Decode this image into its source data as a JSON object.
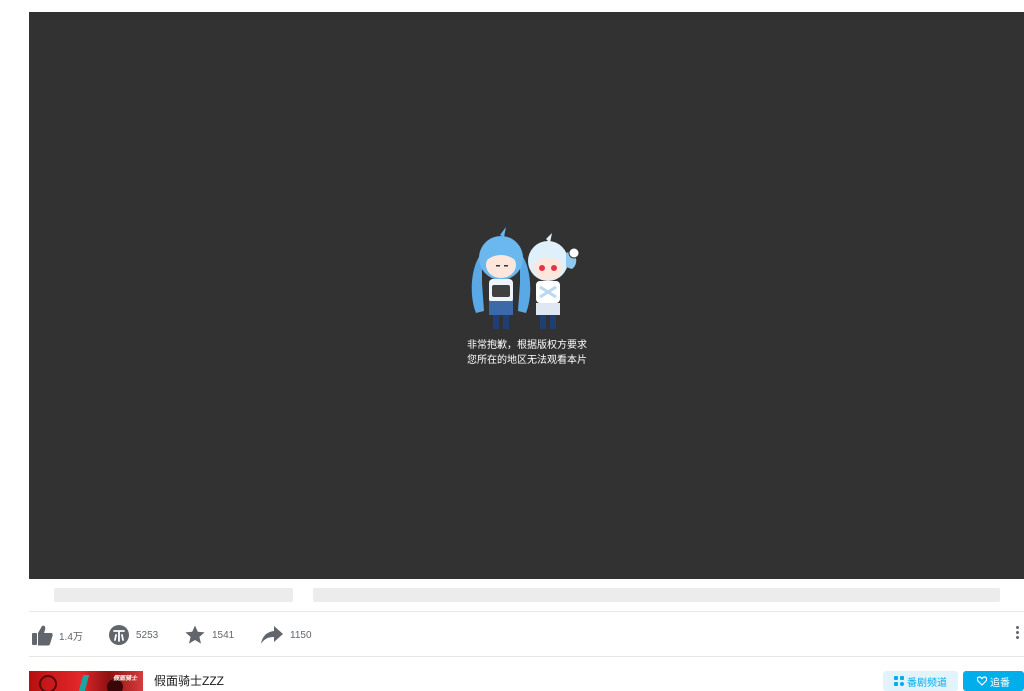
{
  "player": {
    "notice_line1": "非常抱歉，根据版权方要求",
    "notice_line2": "您所在的地区无法观看本片"
  },
  "toolbar": {
    "like_count": "1.4万",
    "coin_count": "5253",
    "favorite_count": "1541",
    "share_count": "1150",
    "icons": [
      "like-icon",
      "coin-icon",
      "favorite-icon",
      "share-icon",
      "more-icon"
    ]
  },
  "series": {
    "title": "假面骑士ZZZ",
    "cover_tag": "假面骑士",
    "channel_button": "番剧频道",
    "follow_button": "追番"
  },
  "colors": {
    "player_bg": "#323232",
    "accent": "#00aeec",
    "icon_gray": "#61666d"
  }
}
